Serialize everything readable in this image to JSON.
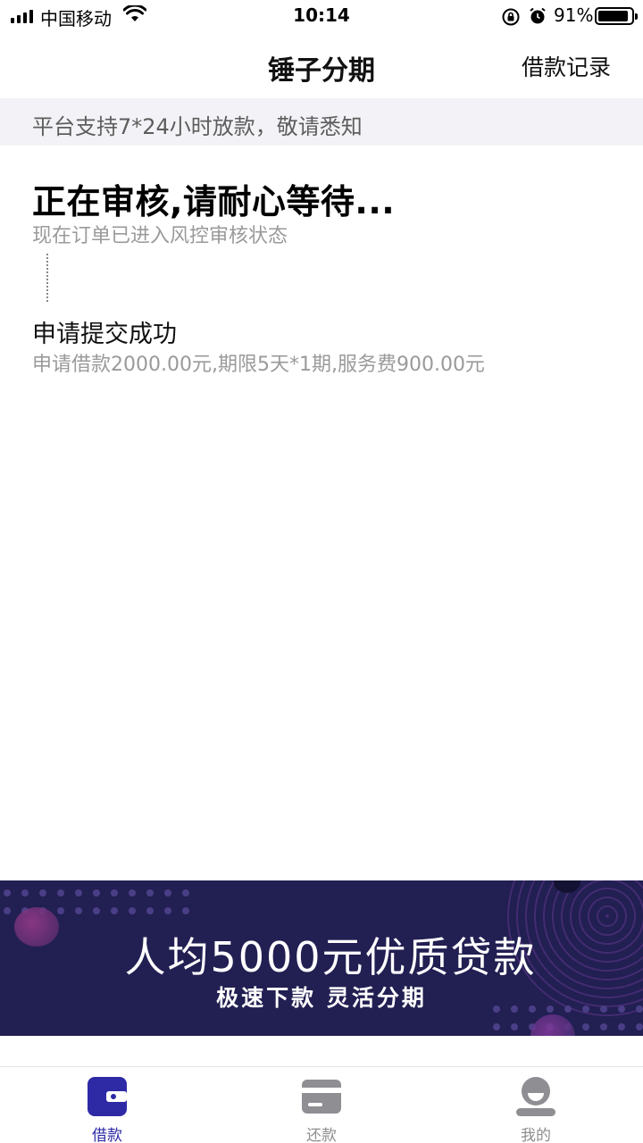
{
  "status_bar": {
    "carrier": "中国移动",
    "time": "10:14",
    "battery_percent": "91%",
    "battery_level": 0.91,
    "icons": [
      "signal-icon",
      "wifi-icon",
      "rotation-lock-icon",
      "alarm-icon",
      "battery-icon"
    ]
  },
  "nav": {
    "title": "锤子分期",
    "right_link": "借款记录"
  },
  "notice": {
    "text": "平台支持7*24小时放款，敬请悉知"
  },
  "progress": {
    "current_title": "正在审核,请耐心等待...",
    "current_desc": "现在订单已进入风控审核状态",
    "step_title": "申请提交成功",
    "step_desc": "申请借款2000.00元,期限5天*1期,服务费900.00元"
  },
  "banner": {
    "title": "人均5000元优质贷款",
    "subtitle": "极速下款 灵活分期"
  },
  "tabs": [
    {
      "label": "借款",
      "icon": "wallet-icon",
      "active": true
    },
    {
      "label": "还款",
      "icon": "card-icon",
      "active": false
    },
    {
      "label": "我的",
      "icon": "profile-icon",
      "active": false
    }
  ],
  "colors": {
    "accent": "#2e2aa6",
    "banner_bg": "#221f52",
    "notice_bg": "#f3f3f7",
    "inactive_icon": "#8e8e93"
  }
}
